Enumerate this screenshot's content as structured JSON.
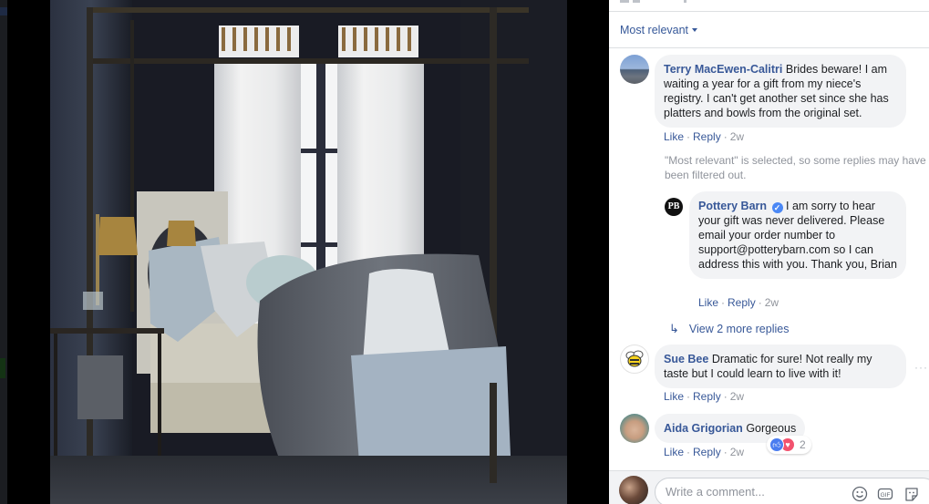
{
  "photo": {
    "alt_subject": "canopy-bed-bedroom-photo"
  },
  "comments_panel": {
    "sort": {
      "label": "Most relevant"
    },
    "comments": [
      {
        "author": "Terry MacEwen-Calitri",
        "text": "Brides beware! I am waiting a year for a gift from my niece's registry. I can't get another set since she has platters and bowls from the original set.",
        "actions": {
          "like": "Like",
          "reply": "Reply",
          "time": "2w"
        }
      }
    ],
    "filter_notice": "\"Most relevant\" is selected, so some replies may have been filtered out.",
    "reply": {
      "author": "Pottery Barn",
      "avatar_text": "PB",
      "verified": true,
      "text": "I am sorry to hear your gift was never delivered. Please email your order number to support@potterybarn.com so I can address this with you. Thank you, Brian",
      "actions": {
        "like": "Like",
        "reply": "Reply",
        "time": "2w"
      }
    },
    "view_more_replies": "View 2 more replies",
    "comment2": {
      "author": "Sue Bee",
      "text": "Dramatic for sure! Not really my taste but I could learn to live with it!",
      "actions": {
        "like": "Like",
        "reply": "Reply",
        "time": "2w"
      },
      "more_label": "···"
    },
    "comment3": {
      "author": "Aida Grigorian",
      "text": "Gorgeous",
      "actions": {
        "like": "Like",
        "reply": "Reply",
        "time": "2w"
      },
      "reactions": {
        "types": [
          "like",
          "love"
        ],
        "count": "2"
      }
    },
    "composer": {
      "placeholder": "Write a comment...",
      "icons": [
        "emoji-icon",
        "gif-icon",
        "sticker-icon"
      ]
    }
  }
}
